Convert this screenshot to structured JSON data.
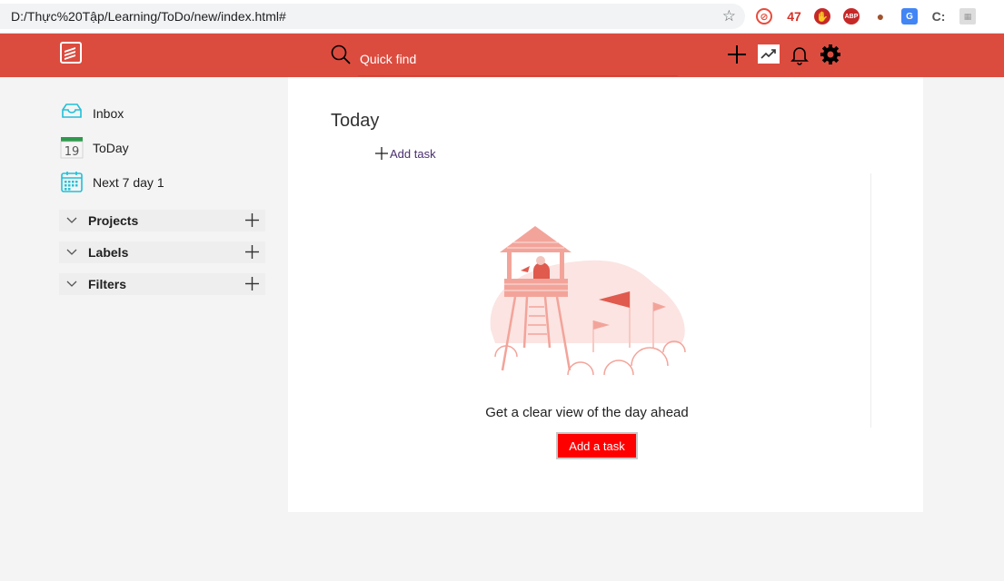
{
  "browser": {
    "url": "D:/Thực%20Tập/Learning/ToDo/new/index.html#",
    "extensions": [
      "47",
      "ABP",
      "C:"
    ]
  },
  "header": {
    "search_placeholder": "Quick find",
    "brand_color": "#db4c3f"
  },
  "sidebar": {
    "items": [
      {
        "label": "Inbox",
        "icon": "inbox-icon"
      },
      {
        "label": "ToDay",
        "icon": "calendar-today-icon",
        "day": "19"
      },
      {
        "label": "Next 7 day 1",
        "icon": "calendar-week-icon"
      }
    ],
    "sections": [
      {
        "label": "Projects"
      },
      {
        "label": "Labels"
      },
      {
        "label": "Filters"
      }
    ]
  },
  "main": {
    "title": "Today",
    "add_task_label": "Add task",
    "empty_message": "Get a clear view of the day ahead",
    "add_button_label": "Add a task"
  }
}
